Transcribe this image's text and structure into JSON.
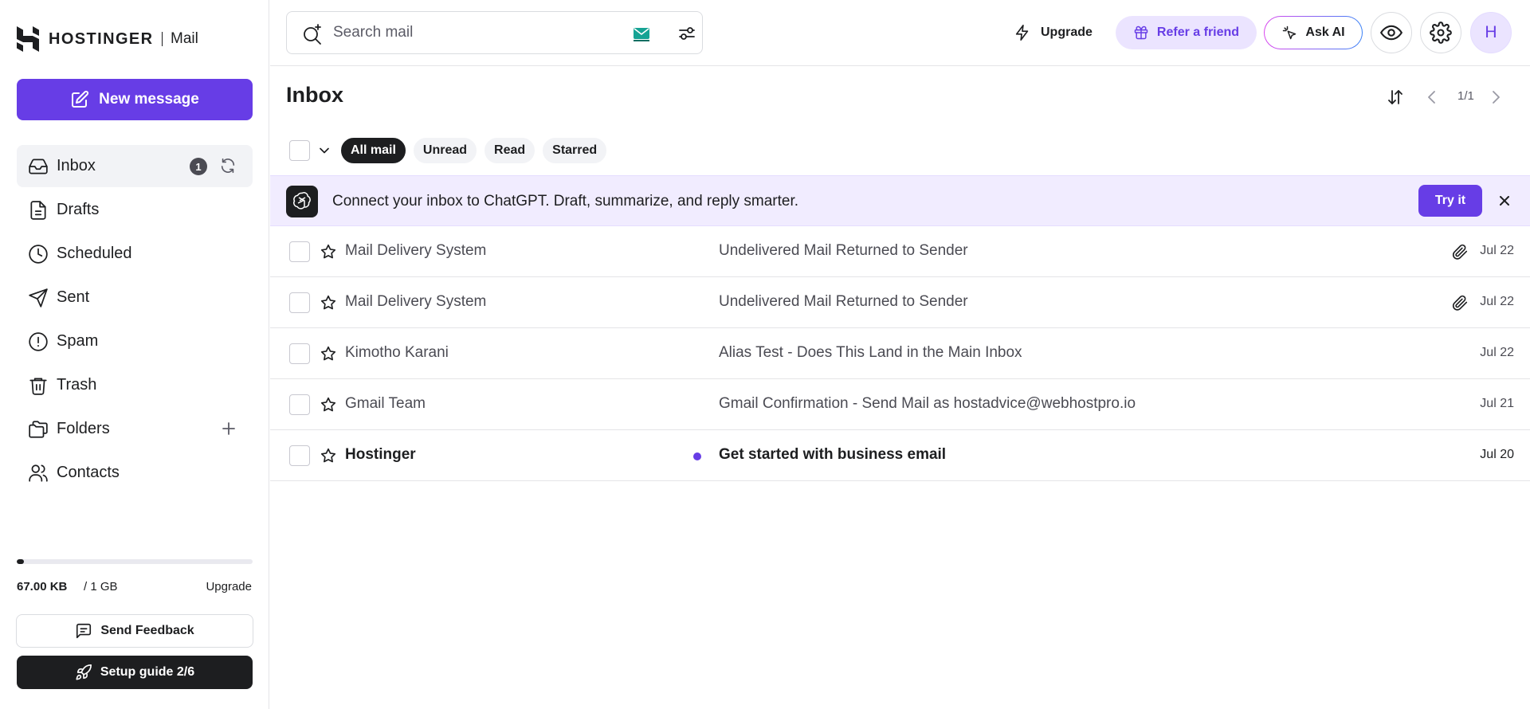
{
  "app": {
    "brand": "HOSTINGER",
    "product": "Mail"
  },
  "sidebar": {
    "new_message": "New message",
    "items": [
      {
        "label": "Inbox",
        "badge": "1",
        "icon": "inbox-icon",
        "active": true
      },
      {
        "label": "Drafts",
        "icon": "drafts-icon"
      },
      {
        "label": "Scheduled",
        "icon": "clock-icon"
      },
      {
        "label": "Sent",
        "icon": "send-icon"
      },
      {
        "label": "Spam",
        "icon": "alert-icon"
      },
      {
        "label": "Trash",
        "icon": "trash-icon"
      },
      {
        "label": "Folders",
        "icon": "folders-icon"
      },
      {
        "label": "Contacts",
        "icon": "contacts-icon"
      }
    ],
    "storage": {
      "used": "67.00 KB",
      "total": "/ 1 GB",
      "upgrade": "Upgrade",
      "used_fraction": 0.03
    },
    "feedback": "Send Feedback",
    "setup": "Setup guide 2/6"
  },
  "topbar": {
    "search_placeholder": "Search mail",
    "upgrade": "Upgrade",
    "refer": "Refer a friend",
    "ask_ai": "Ask AI",
    "avatar_initial": "H"
  },
  "main": {
    "title": "Inbox",
    "page_count": "1/1",
    "filters": [
      "All mail",
      "Unread",
      "Read",
      "Starred"
    ],
    "selected_filter": "All mail",
    "banner": {
      "text": "Connect your inbox to ChatGPT. Draft, summarize, and reply smarter.",
      "cta": "Try it"
    },
    "emails": [
      {
        "sender": "Mail Delivery System",
        "subject": "Undelivered Mail Returned to Sender",
        "date": "Jul 22",
        "attachment": true,
        "unread": false
      },
      {
        "sender": "Mail Delivery System",
        "subject": "Undelivered Mail Returned to Sender",
        "date": "Jul 22",
        "attachment": true,
        "unread": false
      },
      {
        "sender": "Kimotho Karani",
        "subject": "Alias Test - Does This Land in the Main Inbox",
        "date": "Jul 22",
        "attachment": false,
        "unread": false
      },
      {
        "sender": "Gmail Team",
        "subject": "Gmail Confirmation - Send Mail as hostadvice@webhostpro.io",
        "date": "Jul 21",
        "attachment": false,
        "unread": false
      },
      {
        "sender": "Hostinger",
        "subject": "Get started with business email",
        "date": "Jul 20",
        "attachment": false,
        "unread": true
      }
    ]
  },
  "colors": {
    "accent": "#673de6",
    "dark": "#1d1e20",
    "banner_bg": "#f1ecff"
  }
}
